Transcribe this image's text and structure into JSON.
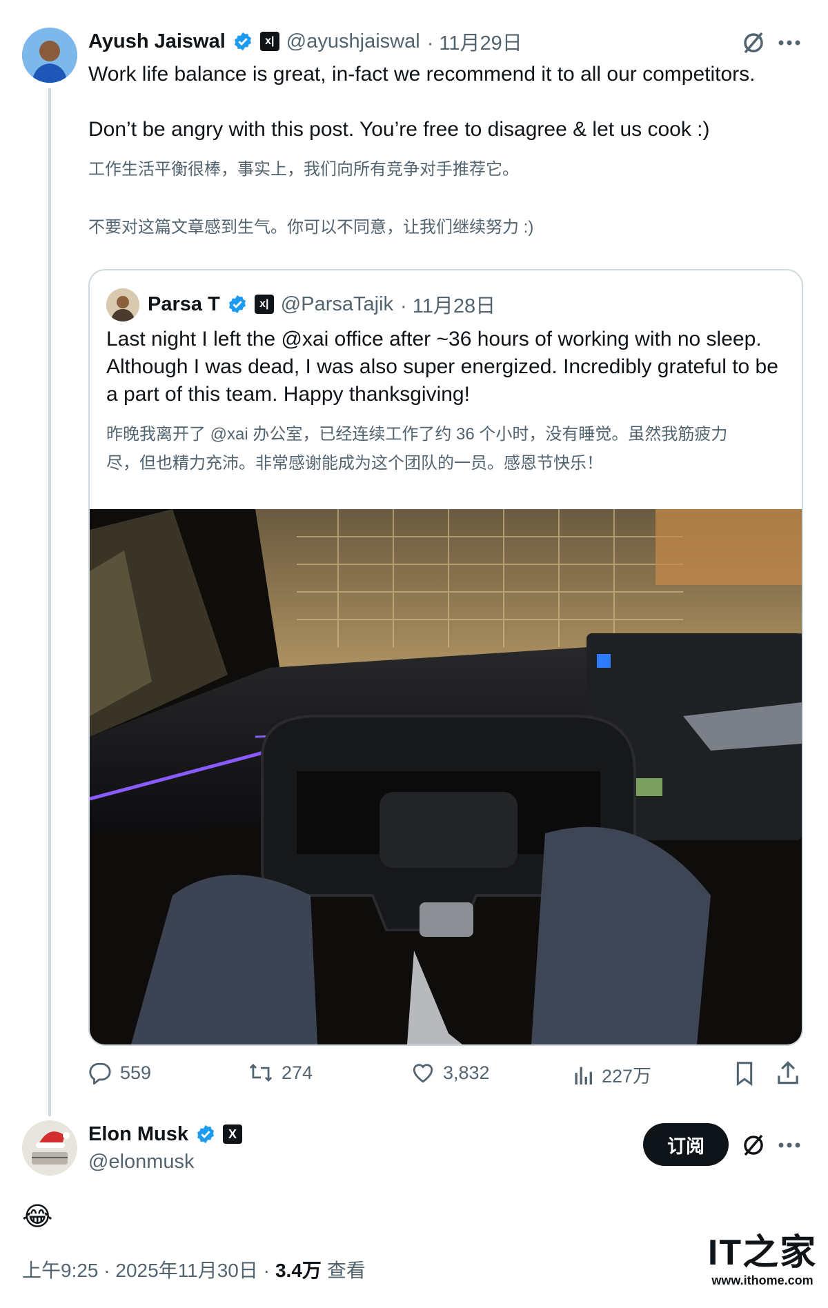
{
  "tweet": {
    "author_name": "Ayush Jaiswal",
    "author_handle": "@ayushjaiswal",
    "date": "· 11月29日",
    "text_en_1": "Work life balance is great, in-fact we recommend it to all our competitors.",
    "text_en_2": "Don’t be angry with this post. You’re free to disagree & let us cook :)",
    "text_zh_1": "工作生活平衡很棒，事实上，我们向所有竞争对手推荐它。",
    "text_zh_2": "不要对这篇文章感到生气。你可以不同意，让我们继续努力 :)",
    "quote": {
      "author_name": "Parsa T",
      "author_handle": "@ParsaTajik",
      "date": "· 11月28日",
      "text_en": "Last night I left the @xai office after ~36 hours of working with no sleep. Although I was dead, I was also super energized. Incredibly grateful to be a part of this team. Happy thanksgiving!",
      "text_zh_1": "昨晚我离开了 @xai 办公室，已经连续工作了约 36 个小时，没有睡觉。虽然我筋疲力",
      "text_zh_2": "尽，但也精力充沛。非常感谢能成为这个团队的一员。感恩节快乐！"
    },
    "stats": {
      "replies": "559",
      "retweets": "274",
      "likes": "3,832",
      "views": "227万"
    }
  },
  "reply": {
    "author_name": "Elon Musk",
    "author_handle": "@elonmusk",
    "subscribe_label": "订阅",
    "content": "😂",
    "time": "上午9:25 · 2025年11月30日 ·",
    "views_count": "3.4万",
    "views_label": "查看"
  },
  "watermark": {
    "logo_text": "IT之家",
    "url": "www.ithome.com"
  },
  "colors": {
    "verified": "#1d9bf0",
    "secondary_text": "#536471",
    "border": "#cfd9de"
  },
  "icons": [
    "verified-badge-icon",
    "x-affiliate-icon",
    "grok-icon",
    "more-icon",
    "reply-icon",
    "retweet-icon",
    "like-icon",
    "views-icon",
    "bookmark-icon",
    "share-icon"
  ]
}
